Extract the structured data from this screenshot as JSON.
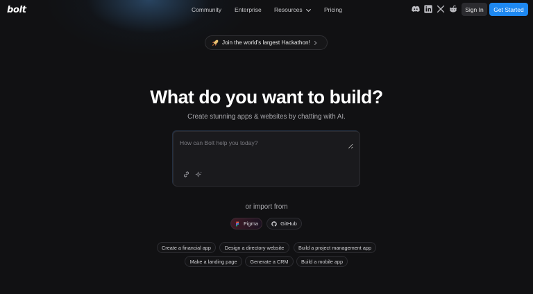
{
  "header": {
    "logo": "bolt",
    "nav": [
      {
        "label": "Community"
      },
      {
        "label": "Enterprise"
      },
      {
        "label": "Resources"
      },
      {
        "label": "Pricing"
      }
    ],
    "social_icons": [
      "discord-icon",
      "linkedin-icon",
      "x-icon",
      "reddit-icon"
    ],
    "sign_in": "Sign In",
    "get_started": "Get Started"
  },
  "banner": {
    "icon": "rocket-icon",
    "text": "Join the world’s largest Hackathon!"
  },
  "hero": {
    "title": "What do you want to build?",
    "subtitle": "Create stunning apps & websites by chatting with AI."
  },
  "prompt": {
    "placeholder": "How can Bolt help you today?",
    "value": "",
    "icons": [
      "link-icon",
      "sparkle-icon"
    ]
  },
  "import": {
    "label": "or import from",
    "buttons": [
      {
        "label": "Figma",
        "icon": "figma-icon"
      },
      {
        "label": "GitHub",
        "icon": "github-icon"
      }
    ]
  },
  "suggestions": {
    "row1": [
      "Create a financial app",
      "Design a directory website",
      "Build a project management app"
    ],
    "row2": [
      "Make a landing page",
      "Generate a CRM",
      "Build a mobile app"
    ]
  },
  "colors": {
    "background": "#111113",
    "accent": "#1e88f0",
    "text_primary": "#ffffff",
    "text_muted": "#a8a8ad"
  }
}
